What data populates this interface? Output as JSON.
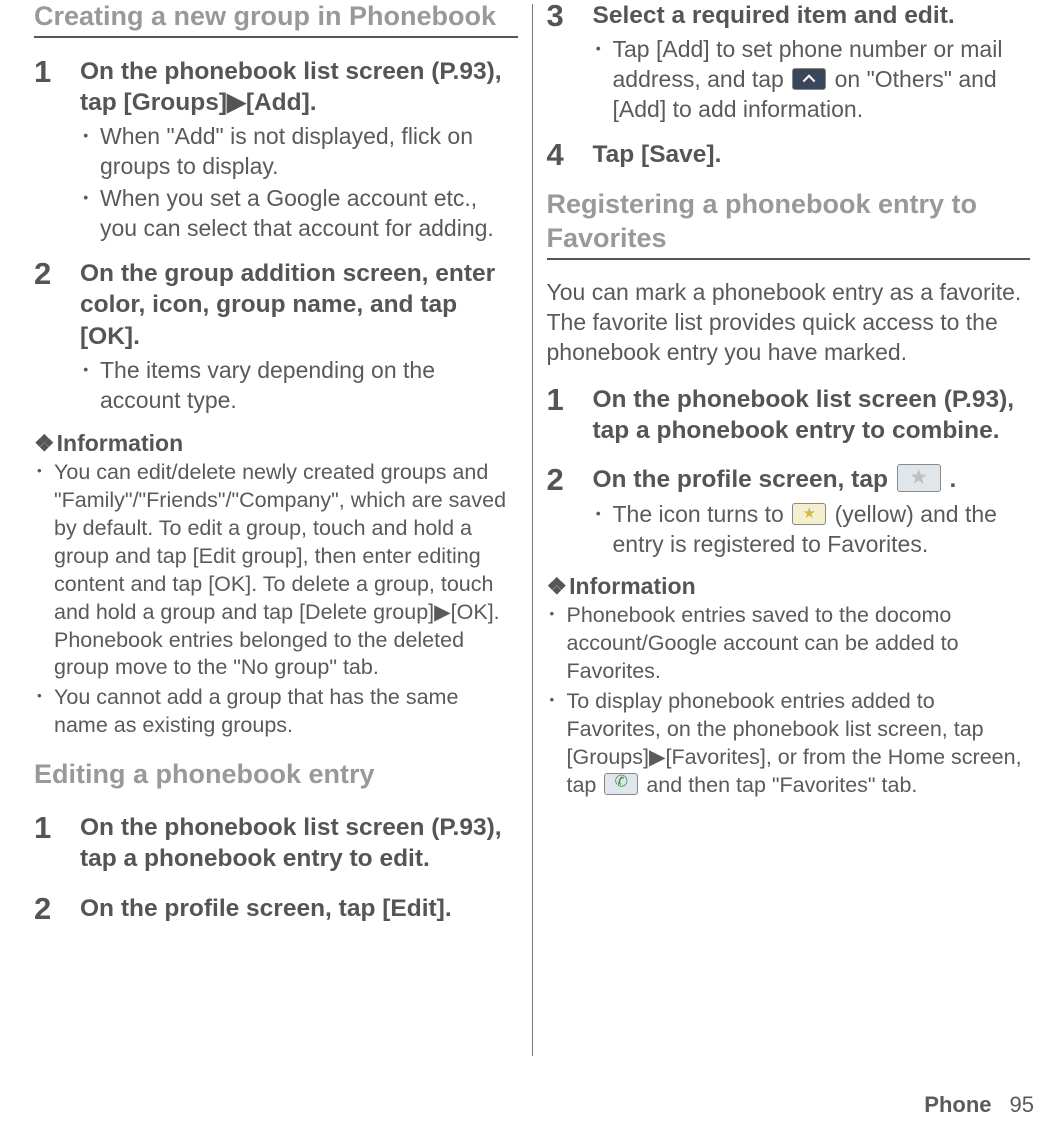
{
  "left": {
    "section1_title": "Creating a new group in Phonebook",
    "step1_num": "1",
    "step1_head": "On the phonebook list screen (P.93), tap [Groups]▶[Add].",
    "step1_b1": "When \"Add\" is not displayed, flick on groups to display.",
    "step1_b2": "When you set a Google account etc., you can select that account for adding.",
    "step2_num": "2",
    "step2_head": "On the group addition screen, enter color, icon, group name, and tap [OK].",
    "step2_b1": "The items vary depending on the account type.",
    "info_label": "Information",
    "info_b1": "You can edit/delete newly created groups and \"Family\"/\"Friends\"/\"Company\", which are saved by default. To edit a group, touch and hold a group and tap [Edit group], then enter editing content and tap [OK]. To delete a group, touch and hold a group and tap [Delete group]▶[OK]. Phonebook entries belonged to the deleted group move to the \"No group\" tab.",
    "info_b2": "You cannot add a group that has the same name as existing groups.",
    "section2_title": "Editing a phonebook entry",
    "edit_step1_num": "1",
    "edit_step1_head": "On the phonebook list screen (P.93), tap a phonebook entry to edit.",
    "edit_step2_num": "2",
    "edit_step2_head": "On the profile screen, tap [Edit]."
  },
  "right": {
    "step3_num": "3",
    "step3_head": "Select a required item and edit.",
    "step3_b1a": "Tap [Add] to set phone number or mail address, and tap ",
    "step3_b1b": " on \"Others\" and [Add] to add information.",
    "step4_num": "4",
    "step4_head": "Tap [Save].",
    "section_title": "Registering a phonebook entry to Favorites",
    "intro": "You can mark a phonebook entry as a favorite. The favorite list provides quick access to the phonebook entry you have marked.",
    "fav_step1_num": "1",
    "fav_step1_head": "On the phonebook list screen (P.93), tap a phonebook entry to combine.",
    "fav_step2_num": "2",
    "fav_step2_head_a": "On the profile screen, tap ",
    "fav_step2_head_b": " .",
    "fav_step2_b1a": "The icon turns to ",
    "fav_step2_b1b": " (yellow) and the entry is registered to Favorites.",
    "info_label": "Information",
    "info_b1": "Phonebook entries saved to the docomo account/Google account can be added to Favorites.",
    "info_b2a": "To display phonebook entries added to Favorites, on the phonebook list screen, tap [Groups]▶[Favorites], or from the Home screen, tap ",
    "info_b2b": " and then tap \"Favorites\" tab."
  },
  "footer": {
    "label": "Phone",
    "page": "95"
  }
}
